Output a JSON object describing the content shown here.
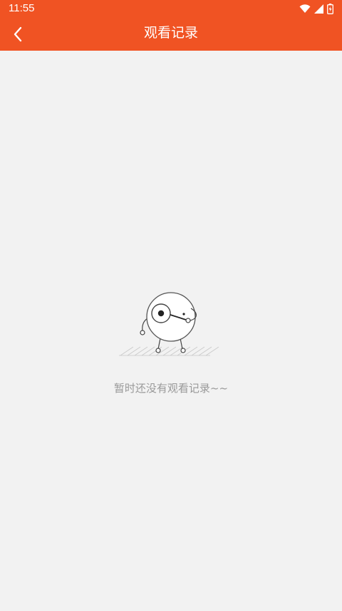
{
  "status_bar": {
    "time": "11:55",
    "icons": [
      "wifi-icon",
      "cellular-signal-icon",
      "battery-charging-icon"
    ]
  },
  "header": {
    "title": "观看记录",
    "back_icon": "chevron-left-icon",
    "background_color": "#f05323",
    "text_color": "#ffffff"
  },
  "empty_state": {
    "message": "暂时还没有观看记录~~",
    "illustration": "magnifier-character-illustration",
    "text_color": "#999999"
  },
  "colors": {
    "page_background": "#f2f2f2"
  }
}
